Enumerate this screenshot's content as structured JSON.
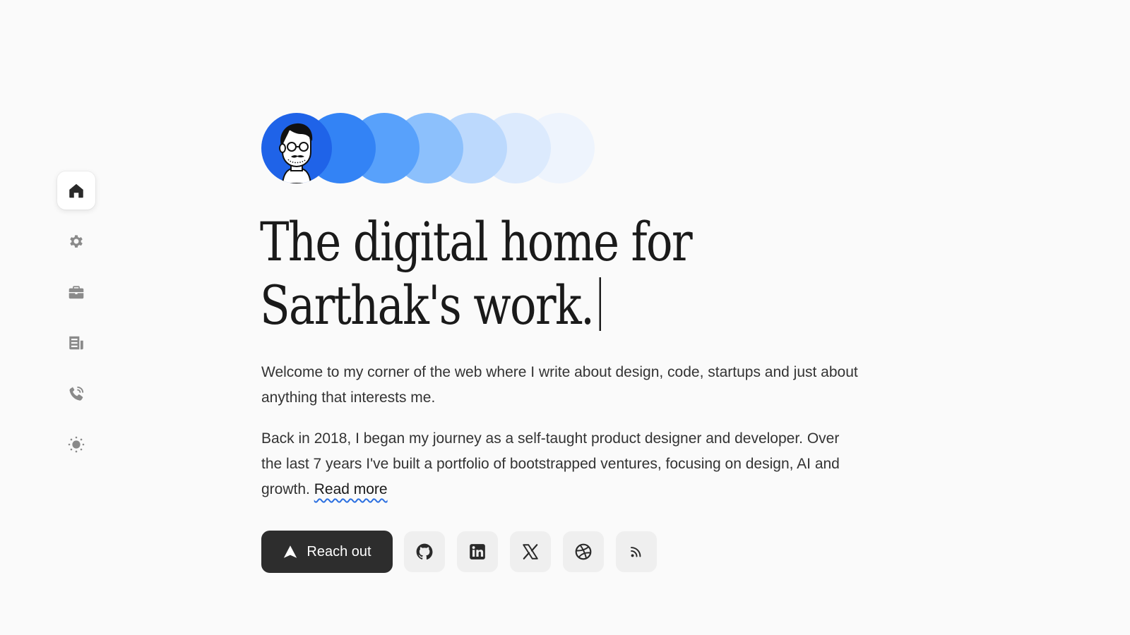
{
  "sidebar": {
    "items": [
      {
        "name": "home",
        "icon": "home-icon",
        "active": true
      },
      {
        "name": "settings",
        "icon": "gear-icon",
        "active": false
      },
      {
        "name": "work",
        "icon": "briefcase-icon",
        "active": false
      },
      {
        "name": "blog",
        "icon": "newspaper-icon",
        "active": false
      },
      {
        "name": "contact",
        "icon": "phone-icon",
        "active": false
      },
      {
        "name": "theme-toggle",
        "icon": "sun-icon",
        "active": false
      }
    ]
  },
  "avatar": {
    "icon": "avatar-illustration",
    "circle_colors": [
      "#1f63e8",
      "#3383f5",
      "#58a1fb",
      "#8cc0fc",
      "#bcd9fd",
      "#dceafd",
      "#eef4fd"
    ]
  },
  "hero": {
    "headline_line1": "The digital home for",
    "headline_line2": "Sarthak's work."
  },
  "intro": {
    "paragraph1": "Welcome to my corner of the web where I write about design, code, startups and just about anything that interests me.",
    "paragraph2": "Back in 2018, I began my journey as a self-taught product designer and developer. Over the last 7 years I've built a portfolio of bootstrapped ventures, focusing on design, AI and growth.",
    "read_more": "Read more"
  },
  "actions": {
    "reach_out_label": "Reach out",
    "reach_out_icon": "send-icon",
    "socials": [
      {
        "name": "github",
        "icon": "github-icon"
      },
      {
        "name": "linkedin",
        "icon": "linkedin-icon"
      },
      {
        "name": "x",
        "icon": "x-icon"
      },
      {
        "name": "dribbble",
        "icon": "dribbble-icon"
      },
      {
        "name": "rss",
        "icon": "rss-icon"
      }
    ]
  },
  "colors": {
    "background": "#fafafa",
    "primary_blue": "#1f63e8",
    "button_dark": "#2d2d2d",
    "icon_gray": "#8a8a8a",
    "social_bg": "#efefef",
    "link_underline": "#2b6fe0"
  }
}
